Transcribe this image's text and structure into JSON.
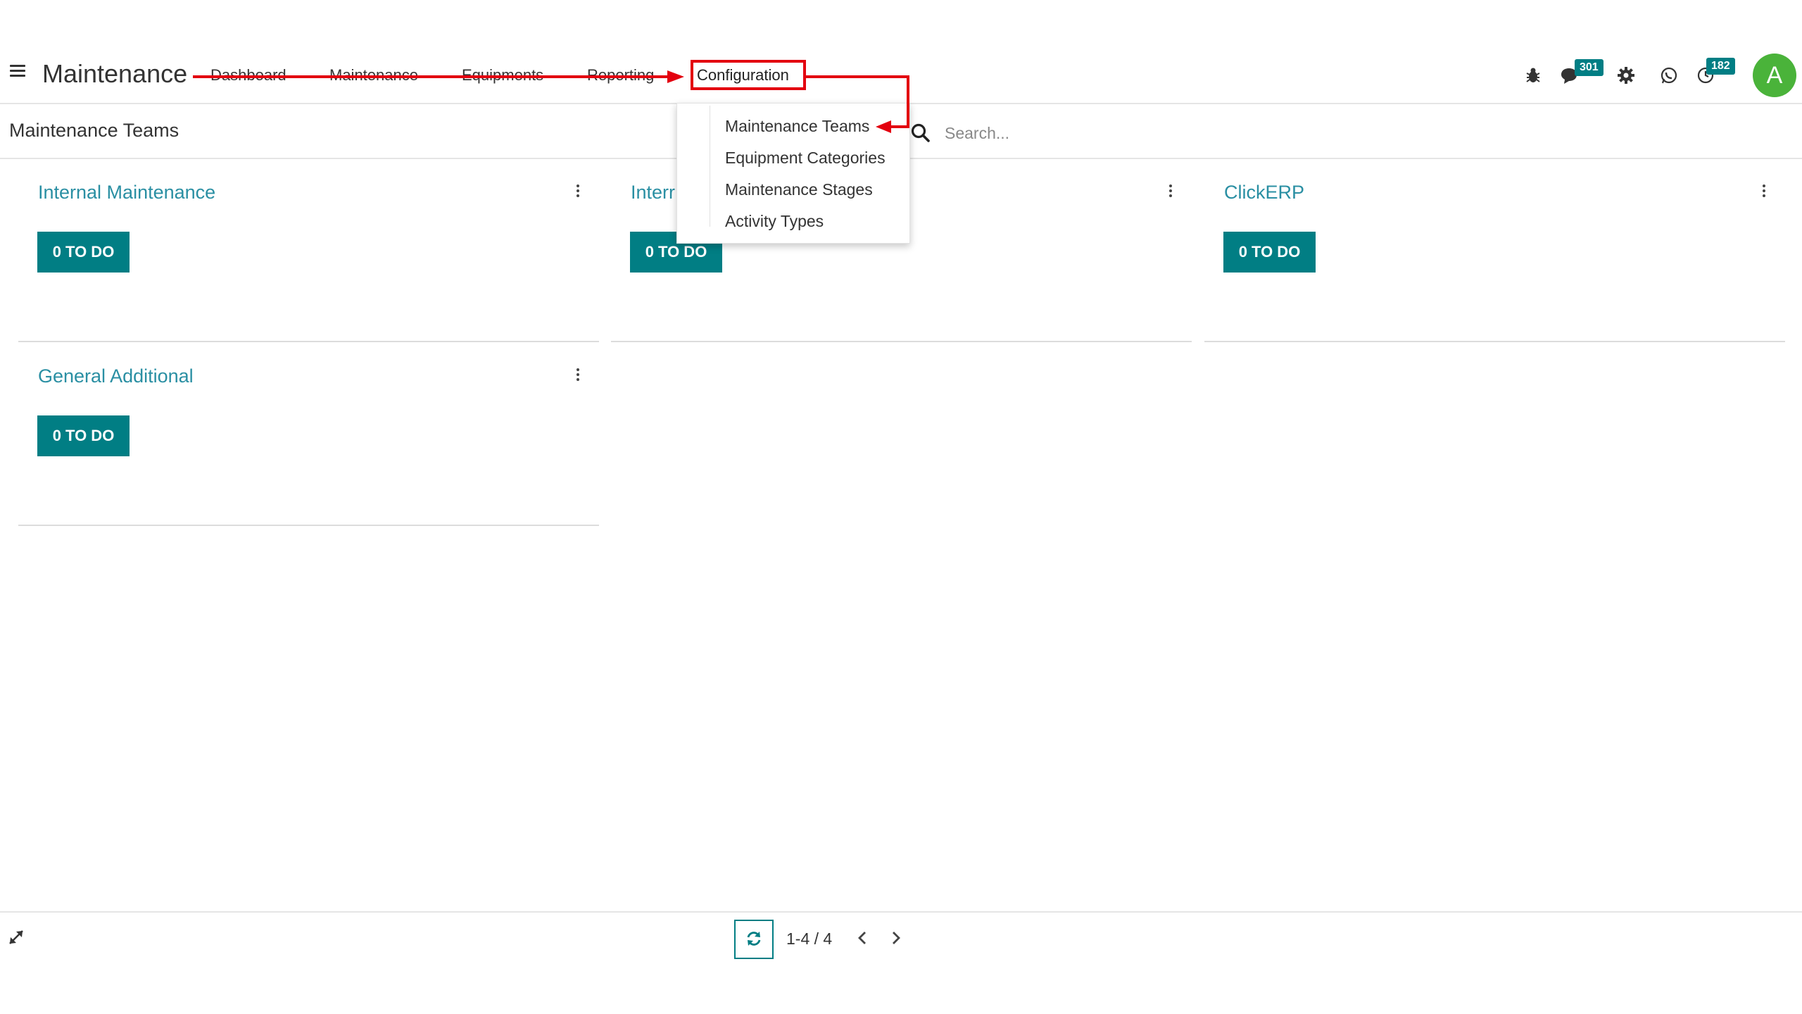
{
  "app": {
    "title": "Maintenance"
  },
  "menu": {
    "items": [
      "Dashboard",
      "Maintenance",
      "Equipments",
      "Reporting"
    ],
    "active": "Configuration"
  },
  "systray": {
    "messages_count": "301",
    "activities_count": "182",
    "avatar_letter": "A"
  },
  "control_panel": {
    "breadcrumb": "Maintenance Teams",
    "search_placeholder": "Search..."
  },
  "dropdown": {
    "items": [
      "Maintenance Teams",
      "Equipment Categories",
      "Maintenance Stages",
      "Activity Types"
    ]
  },
  "teams": [
    {
      "name": "Internal Maintenance",
      "todo": "0 TO DO"
    },
    {
      "name": "Interr",
      "todo": "0 TO DO"
    },
    {
      "name": "ClickERP",
      "todo": "0 TO DO"
    },
    {
      "name": "General Additional",
      "todo": "0 TO DO"
    }
  ],
  "pager": {
    "value": "1-4 / 4"
  },
  "colors": {
    "primary": "#017e84",
    "title_link": "#2a8fa3",
    "avatar": "#4ab33a",
    "annotation": "#e3000f"
  }
}
